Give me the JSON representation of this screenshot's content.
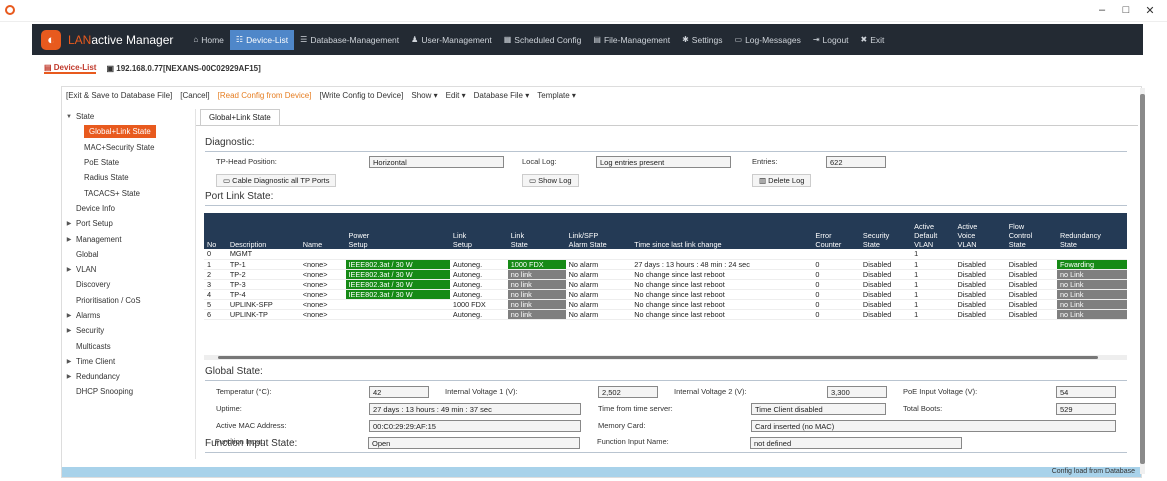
{
  "window": {
    "minimize": "–",
    "maximize": "□",
    "close": "✕"
  },
  "nav": {
    "brand_lan": "LAN",
    "brand_rest": "active Manager",
    "items": [
      {
        "label": "Home",
        "icon": "⌂"
      },
      {
        "label": "Device-List",
        "icon": "☷"
      },
      {
        "label": "Database-Management",
        "icon": "☰"
      },
      {
        "label": "User-Management",
        "icon": "♟"
      },
      {
        "label": "Scheduled Config",
        "icon": "▦"
      },
      {
        "label": "File-Management",
        "icon": "▤"
      },
      {
        "label": "Settings",
        "icon": "✱"
      },
      {
        "label": "Log-Messages",
        "icon": "▭"
      },
      {
        "label": "Logout",
        "icon": "⇥"
      },
      {
        "label": "Exit",
        "icon": "✖"
      }
    ]
  },
  "doc_tabs": [
    "Device-List",
    "192.168.0.77[NEXANS-00C02929AF15]"
  ],
  "toolbar": [
    "[Exit & Save to Database File]",
    "[Cancel]",
    "[Read Config from Device]",
    "[Write Config to Device]",
    "Show ▾",
    "Edit ▾",
    "Database File ▾",
    "Template ▾"
  ],
  "tree": [
    {
      "label": "State",
      "level": 0,
      "arrow": "▼"
    },
    {
      "label": "Global+Link State",
      "level": 1,
      "selected": true
    },
    {
      "label": "MAC+Security State",
      "level": 1
    },
    {
      "label": "PoE State",
      "level": 1
    },
    {
      "label": "Radius State",
      "level": 1
    },
    {
      "label": "TACACS+ State",
      "level": 1
    },
    {
      "label": "Device Info",
      "level": 0
    },
    {
      "label": "Port Setup",
      "level": 0,
      "arrow": "▶"
    },
    {
      "label": "Management",
      "level": 0,
      "arrow": "▶"
    },
    {
      "label": "Global",
      "level": 0
    },
    {
      "label": "VLAN",
      "level": 0,
      "arrow": "▶"
    },
    {
      "label": "Discovery",
      "level": 0
    },
    {
      "label": "Prioritisation / CoS",
      "level": 0
    },
    {
      "label": "Alarms",
      "level": 0,
      "arrow": "▶"
    },
    {
      "label": "Security",
      "level": 0,
      "arrow": "▶"
    },
    {
      "label": "Multicasts",
      "level": 0
    },
    {
      "label": "Time Client",
      "level": 0,
      "arrow": "▶"
    },
    {
      "label": "Redundancy",
      "level": 0,
      "arrow": "▶"
    },
    {
      "label": "DHCP Snooping",
      "level": 0
    }
  ],
  "content_tab": "Global+Link State",
  "diagnostic": {
    "title": "Diagnostic:",
    "tp_head_label": "TP-Head Position:",
    "tp_head_value": "Horizontal",
    "local_log_label": "Local Log:",
    "local_log_value": "Log entries present",
    "entries_label": "Entries:",
    "entries_value": "622",
    "cable_btn": "Cable Diagnostic all TP Ports",
    "show_log_btn": "Show Log",
    "delete_log_btn": "Delete Log"
  },
  "port_link": {
    "title": "Port Link State:",
    "columns": [
      "No",
      "Description",
      "Name",
      "Power\nSetup",
      "Link\nSetup",
      "Link\nState",
      "Link/SFP\nAlarm State",
      "Time since last link change",
      "Error\nCounter",
      "Security\nState",
      "Active\nDefault\nVLAN",
      "Active\nVoice\nVLAN",
      "Flow\nControl\nState",
      "Redundancy\nState"
    ],
    "rows": [
      [
        "0",
        "MGMT",
        "",
        "",
        "",
        "",
        "",
        "",
        "",
        "",
        "1",
        "",
        "",
        ""
      ],
      [
        "1",
        "TP-1",
        "<none>",
        "IEEE802.3at / 30 W",
        "Autoneg.",
        "1000 FDX",
        "No alarm",
        "27 days : 13 hours : 48 min : 24 sec",
        "0",
        "Disabled",
        "1",
        "Disabled",
        "Disabled",
        "Fowarding"
      ],
      [
        "2",
        "TP-2",
        "<none>",
        "IEEE802.3at / 30 W",
        "Autoneg.",
        "no link",
        "No alarm",
        "No change since last reboot",
        "0",
        "Disabled",
        "1",
        "Disabled",
        "Disabled",
        "no Link"
      ],
      [
        "3",
        "TP-3",
        "<none>",
        "IEEE802.3at / 30 W",
        "Autoneg.",
        "no link",
        "No alarm",
        "No change since last reboot",
        "0",
        "Disabled",
        "1",
        "Disabled",
        "Disabled",
        "no Link"
      ],
      [
        "4",
        "TP-4",
        "<none>",
        "IEEE802.3at / 30 W",
        "Autoneg.",
        "no link",
        "No alarm",
        "No change since last reboot",
        "0",
        "Disabled",
        "1",
        "Disabled",
        "Disabled",
        "no Link"
      ],
      [
        "5",
        "UPLINK-SFP",
        "<none>",
        "",
        "1000 FDX",
        "no link",
        "No alarm",
        "No change since last reboot",
        "0",
        "Disabled",
        "1",
        "Disabled",
        "Disabled",
        "no Link"
      ],
      [
        "6",
        "UPLINK-TP",
        "<none>",
        "",
        "Autoneg.",
        "no link",
        "No alarm",
        "No change since last reboot",
        "0",
        "Disabled",
        "1",
        "Disabled",
        "Disabled",
        "no Link"
      ]
    ]
  },
  "global_state": {
    "title": "Global State:",
    "temp_label": "Temperatur (°C):",
    "temp_value": "42",
    "iv1_label": "Internal Voltage 1 (V):",
    "iv1_value": "2,502",
    "iv2_label": "Internal Voltage 2 (V):",
    "iv2_value": "3,300",
    "poe_label": "PoE Input Voltage (V):",
    "poe_value": "54",
    "uptime_label": "Uptime:",
    "uptime_value": "27 days : 13 hours : 49 min : 37 sec",
    "time_server_label": "Time from time server:",
    "time_server_value": "Time Client disabled",
    "boots_label": "Total Boots:",
    "boots_value": "529",
    "mac_label": "Active MAC Address:",
    "mac_value": "00:C0:29:29:AF:15",
    "memcard_label": "Memory Card:",
    "memcard_value": "Card inserted (no MAC)"
  },
  "function_input": {
    "title": "Function Input State:",
    "fi_label": "Function Input:",
    "fi_value": "Open",
    "fin_label": "Function Input Name:",
    "fin_value": "not defined"
  },
  "status": "Config load from Database"
}
